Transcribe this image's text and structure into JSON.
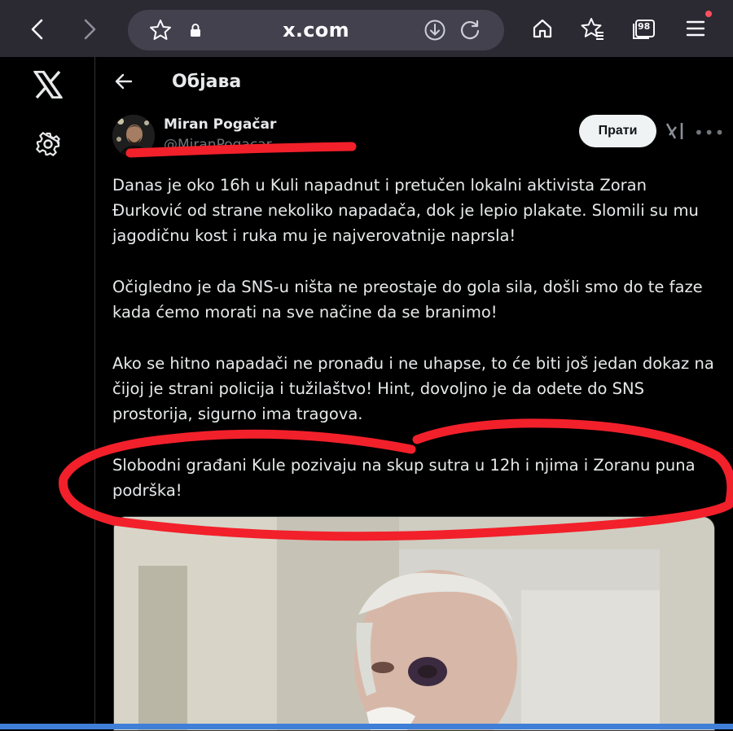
{
  "browser": {
    "url": "x.com",
    "tab_count": "98",
    "icons": [
      "back-icon",
      "forward-icon",
      "bookmark-star-icon",
      "lock-icon",
      "download-icon",
      "reload-icon",
      "home-icon",
      "bookmarks-icon",
      "tabs-icon",
      "menu-icon"
    ]
  },
  "sidebar": {
    "logo": "x-logo-icon",
    "settings": "gear-icon"
  },
  "header": {
    "title": "Објава"
  },
  "post": {
    "author_name": "Miran Pogačar",
    "author_handle": "@MiranPogacar",
    "follow_label": "Прати",
    "paragraphs": [
      "Danas je oko 16h u Kuli napadnut i pretučen lokalni aktivista Zoran Đurković od strane nekoliko napadača, dok je lepio plakate. Slomili su mu jagodičnu kost i ruka mu je najverovatnije naprsla!",
      "Očigledno je da SNS-u ništa ne preostaje do gola sila, došli smo do te faze kada ćemo morati na sve načine da se branimo!",
      "Ako se hitno napadači ne pronađu i ne uhapse, to će biti još jedan dokaz na čijoj je strani policija i tužilaštvo! Hint, dovoljno je da odete do SNS prostorija, sigurno ima tragova.",
      "Slobodni građani Kule pozivaju na skup sutra u 12h i njima i Zoranu puna podrška!"
    ]
  },
  "colors": {
    "chrome_bg": "#2b2a33",
    "urlbar_bg": "#42414d",
    "annotation_red": "#f2202a",
    "follow_bg": "#eff3f4",
    "muted_text": "#71767b"
  }
}
